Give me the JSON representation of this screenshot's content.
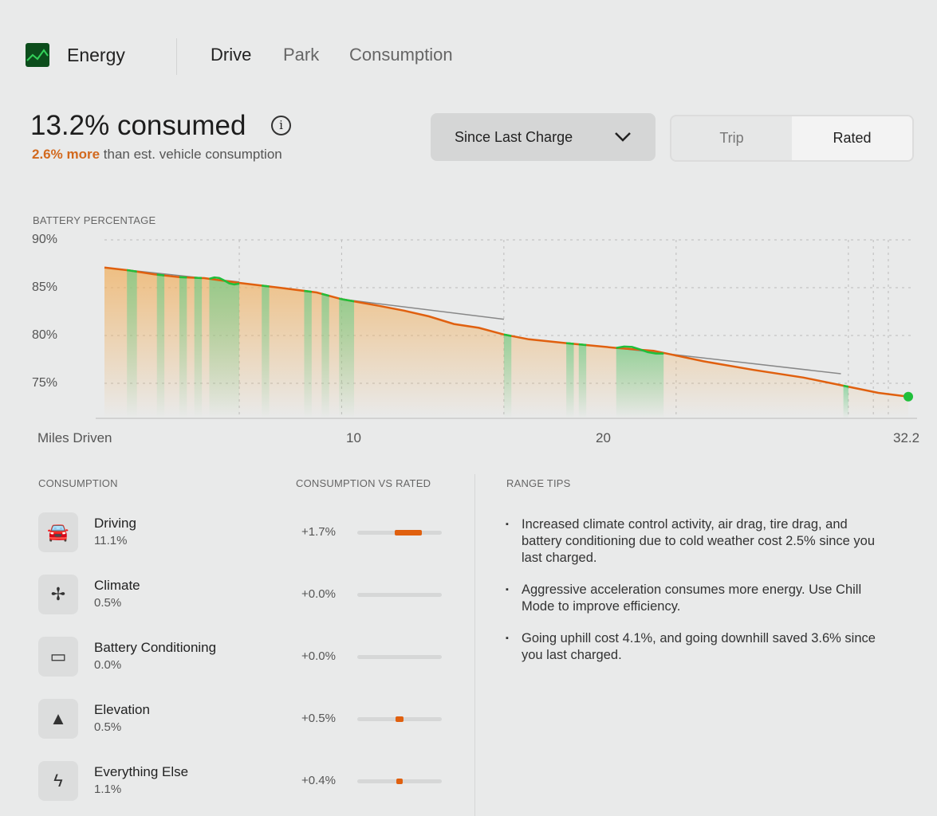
{
  "header": {
    "icon": "energy-chart-icon",
    "title": "Energy",
    "tabs": [
      {
        "label": "Drive",
        "active": true
      },
      {
        "label": "Park",
        "active": false
      },
      {
        "label": "Consumption",
        "active": false
      }
    ]
  },
  "summary": {
    "headline": "13.2% consumed",
    "delta": "2.6% more",
    "delta_rest": " than est. vehicle consumption",
    "accent": "#d2691e"
  },
  "controls": {
    "range": "Since Last Charge",
    "toggle": [
      {
        "label": "Trip",
        "active": false
      },
      {
        "label": "Rated",
        "active": true
      }
    ]
  },
  "chart_data": {
    "type": "line",
    "title": "BATTERY PERCENTAGE",
    "xlabel": "Miles Driven",
    "xlim": [
      0,
      32.2
    ],
    "ylim": [
      72,
      90
    ],
    "yticks": [
      "90%",
      "85%",
      "80%",
      "75%"
    ],
    "ytick_values": [
      90,
      85,
      80,
      75
    ],
    "xticks": [
      "10",
      "20",
      "32.2"
    ],
    "xtick_values": [
      10,
      20,
      32.2
    ],
    "actual": {
      "color": "#e0600f",
      "x": [
        0,
        1,
        2,
        3,
        4,
        5.4,
        7,
        8.5,
        9.5,
        11,
        12,
        13,
        14,
        15,
        16,
        17,
        18.5,
        20.5,
        22,
        24,
        26,
        28,
        29.5,
        31,
        32.2
      ],
      "y": [
        87.1,
        86.8,
        86.4,
        86.1,
        86.0,
        85.5,
        85.0,
        84.5,
        83.8,
        83.1,
        82.6,
        82.0,
        81.2,
        80.8,
        80.1,
        79.6,
        79.2,
        78.7,
        78.4,
        77.3,
        76.4,
        75.6,
        74.8,
        74.0,
        73.6
      ]
    },
    "rated": {
      "color": "#888888",
      "segments": [
        {
          "x": [
            0,
            5.4
          ],
          "y": [
            87.1,
            85.6
          ]
        },
        {
          "x": [
            9.5,
            16
          ],
          "y": [
            83.8,
            81.7
          ]
        },
        {
          "x": [
            20.5,
            29.5
          ],
          "y": [
            78.7,
            76.0
          ]
        }
      ]
    },
    "regen_ranges": [
      [
        0.9,
        1.3
      ],
      [
        2.1,
        2.4
      ],
      [
        3.0,
        3.3
      ],
      [
        3.6,
        3.9
      ],
      [
        4.2,
        5.4
      ],
      [
        6.3,
        6.6
      ],
      [
        8.0,
        8.3
      ],
      [
        8.7,
        9.0
      ],
      [
        9.4,
        10.0
      ],
      [
        16.0,
        16.3
      ],
      [
        18.5,
        18.8
      ],
      [
        19.0,
        19.3
      ],
      [
        20.5,
        22.4
      ],
      [
        29.6,
        29.8
      ]
    ],
    "regen_color": "#5ecf8a",
    "area_color": "#f0b060",
    "endpoint_color": "#1fbf3a"
  },
  "consumption": {
    "header": "CONSUMPTION",
    "vs_header": "CONSUMPTION VS RATED",
    "items": [
      {
        "icon": "car-icon",
        "name": "Driving",
        "value": "11.1%",
        "delta": "+1.7%",
        "bar": 1.7
      },
      {
        "icon": "fan-icon",
        "name": "Climate",
        "value": "0.5%",
        "delta": "+0.0%",
        "bar": 0
      },
      {
        "icon": "battery-icon",
        "name": "Battery Conditioning",
        "value": "0.0%",
        "delta": "+0.0%",
        "bar": 0
      },
      {
        "icon": "mountain-icon",
        "name": "Elevation",
        "value": "0.5%",
        "delta": "+0.5%",
        "bar": 0.5
      },
      {
        "icon": "lightning-icon",
        "name": "Everything Else",
        "value": "1.1%",
        "delta": "+0.4%",
        "bar": 0.4
      }
    ]
  },
  "tips": {
    "header": "RANGE TIPS",
    "items": [
      "Increased climate control activity, air drag, tire drag, and battery conditioning due to cold weather cost 2.5% since you last charged.",
      "Aggressive acceleration consumes more energy. Use Chill Mode to improve efficiency.",
      "Going uphill cost 4.1%, and going downhill saved 3.6% since you last charged."
    ]
  }
}
